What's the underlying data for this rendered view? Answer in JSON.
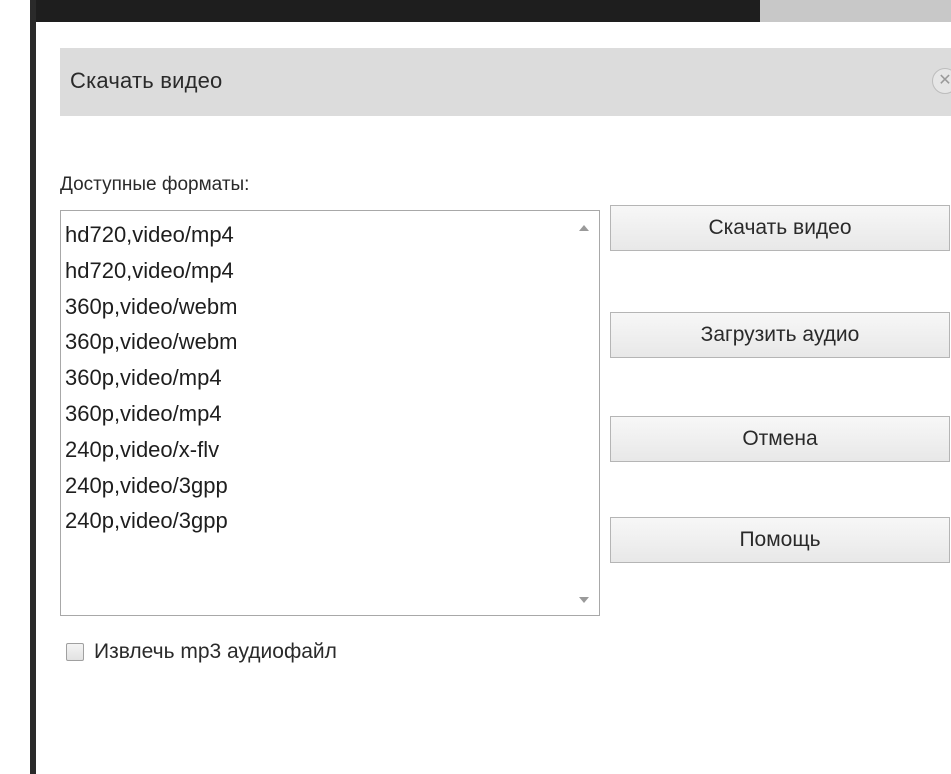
{
  "dialog": {
    "title": "Скачать видео",
    "formats_label": "Доступные форматы:",
    "formats": [
      "hd720,video/mp4",
      "hd720,video/mp4",
      "360p,video/webm",
      "360p,video/webm",
      "360p,video/mp4",
      "360p,video/mp4",
      "240p,video/x-flv",
      "240p,video/3gpp",
      "240p,video/3gpp"
    ],
    "buttons": {
      "download_video": "Скачать видео",
      "download_audio": "Загрузить аудио",
      "cancel": "Отмена",
      "help": "Помощь"
    },
    "extract_mp3_label": "Извлечь mp3 аудиофайл",
    "extract_mp3_checked": false,
    "close_icon": "close-icon"
  }
}
